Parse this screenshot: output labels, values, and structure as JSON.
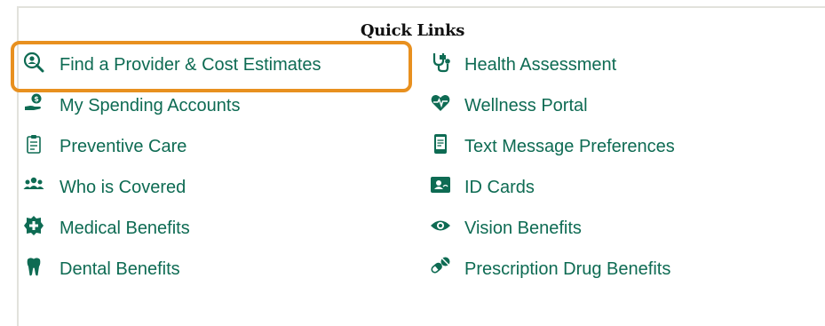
{
  "quick_links": {
    "title": "Quick Links",
    "left": [
      {
        "label": "Find a Provider & Cost Estimates",
        "icon": "find-provider-icon"
      },
      {
        "label": "My Spending Accounts",
        "icon": "spending-accounts-icon"
      },
      {
        "label": "Preventive Care",
        "icon": "clipboard-icon"
      },
      {
        "label": "Who is Covered",
        "icon": "people-group-icon"
      },
      {
        "label": "Medical Benefits",
        "icon": "medical-cross-icon"
      },
      {
        "label": "Dental Benefits",
        "icon": "tooth-icon"
      }
    ],
    "right": [
      {
        "label": "Health Assessment",
        "icon": "stethoscope-icon"
      },
      {
        "label": "Wellness Portal",
        "icon": "heart-pulse-icon"
      },
      {
        "label": "Text Message Preferences",
        "icon": "phone-message-icon"
      },
      {
        "label": "ID Cards",
        "icon": "id-card-icon"
      },
      {
        "label": "Vision Benefits",
        "icon": "eye-icon"
      },
      {
        "label": "Prescription Drug Benefits",
        "icon": "pills-icon"
      }
    ],
    "link_color": "#0e6b53",
    "highlight_color": "#e8901f"
  }
}
